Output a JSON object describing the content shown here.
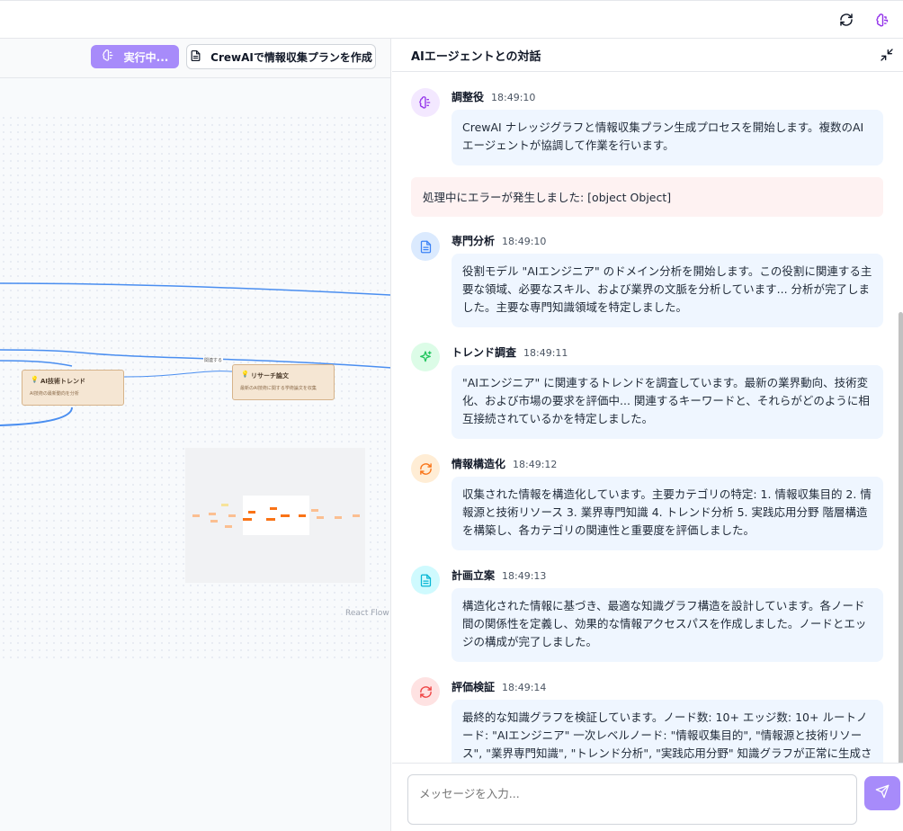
{
  "toolbar": {
    "run_label": "実行中...",
    "plan_label": "CrewAIで情報収集プランを作成"
  },
  "flow": {
    "nodes": [
      {
        "title": "AI技術トレンド",
        "desc": "AI技術の最新動向を分析"
      },
      {
        "title": "リサーチ論文",
        "desc": "最新のAI技術に関する学術論文を収集"
      }
    ],
    "edge_label": "関連する",
    "attribution": "React Flow"
  },
  "chat": {
    "title": "AIエージェントとの対話",
    "error_text": "処理中にエラーが発生しました: [object Object]",
    "input_placeholder": "メッセージを入力...",
    "messages": [
      {
        "sender": "調整役",
        "time": "18:49:10",
        "icon": "brain-icon",
        "color": "#9333ea",
        "text": "CrewAI ナレッジグラフと情報収集プラン生成プロセスを開始します。複数のAIエージェントが協調して作業を行います。"
      },
      {
        "sender": "専門分析",
        "time": "18:49:10",
        "icon": "file-text-icon",
        "color": "#3b82f6",
        "text": "役割モデル \"AIエンジニア\" のドメイン分析を開始します。この役割に関連する主要な領域、必要なスキル、および業界の文脈を分析しています... 分析が完了しました。主要な専門知識領域を特定しました。"
      },
      {
        "sender": "トレンド調査",
        "time": "18:49:11",
        "icon": "sparkles-icon",
        "color": "#22c55e",
        "text": "\"AIエンジニア\" に関連するトレンドを調査しています。最新の業界動向、技術変化、および市場の要求を評価中... 関連するキーワードと、それらがどのように相互接続されているかを特定しました。"
      },
      {
        "sender": "情報構造化",
        "time": "18:49:12",
        "icon": "refresh-icon",
        "color": "#f97316",
        "text": "収集された情報を構造化しています。主要カテゴリの特定: 1. 情報収集目的 2. 情報源と技術リソース 3. 業界専門知識 4. トレンド分析 5. 実践応用分野 階層構造を構築し、各カテゴリの関連性と重要度を評価しました。"
      },
      {
        "sender": "計画立案",
        "time": "18:49:13",
        "icon": "file-text-icon",
        "color": "#06b6d4",
        "text": "構造化された情報に基づき、最適な知識グラフ構造を設計しています。各ノード間の関係性を定義し、効果的な情報アクセスパスを作成しました。ノードとエッジの構成が完了しました。"
      },
      {
        "sender": "評価検証",
        "time": "18:49:14",
        "icon": "refresh-icon",
        "color": "#ef4444",
        "text": "最終的な知識グラフを検証しています。ノード数: 10+ エッジ数: 10+ ルートノード: \"AIエンジニア\" 一次レベルノード: \"情報収集目的\", \"情報源と技術リソース\", \"業界専門知識\", \"トレンド分析\", \"実践応用分野\" 知識グラフが正常に生成されました。"
      }
    ]
  },
  "colors": {
    "accent": "#a78bfa",
    "bubble_bg": "#eff6ff",
    "error_bg": "#fef2f2",
    "node_bg": "#f5e6d3",
    "edge": "#4a8ef0"
  }
}
